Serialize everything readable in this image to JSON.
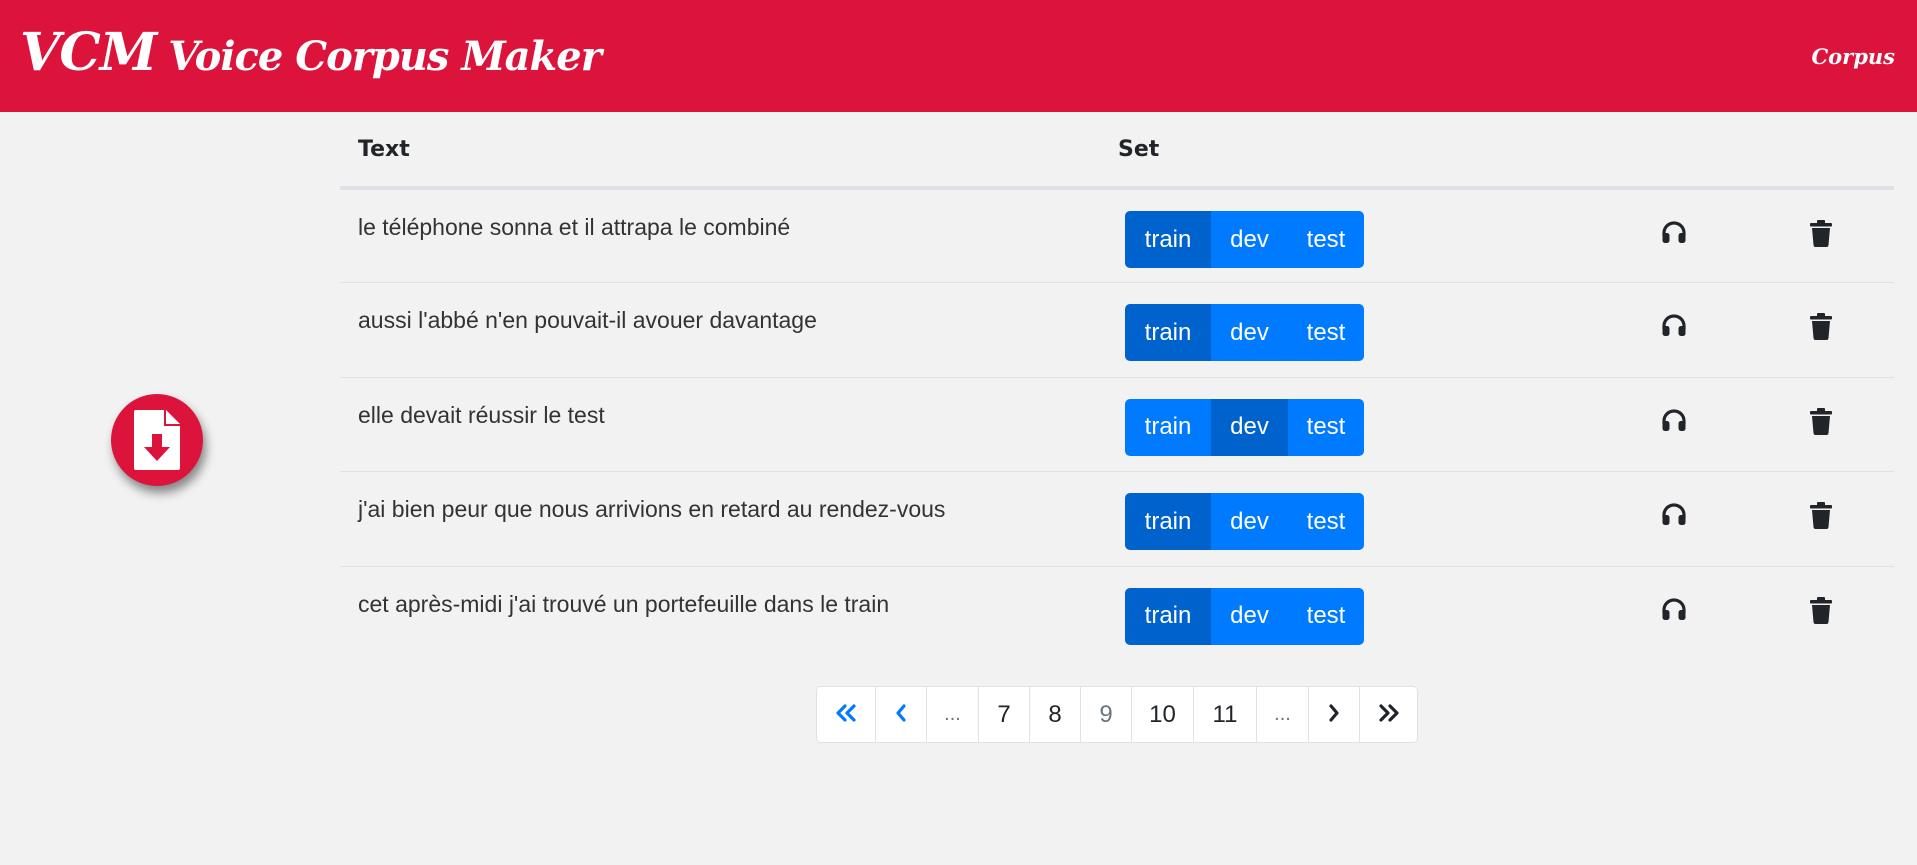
{
  "header": {
    "brand_short": "VCM",
    "brand_long": "Voice Corpus Maker",
    "nav_link": "Corpus",
    "color": "#dc143c"
  },
  "download_button": {
    "icon": "file-download-icon"
  },
  "table": {
    "headers": {
      "text": "Text",
      "set": "Set"
    },
    "rows": [
      {
        "text": "le téléphone sonna et il attrapa le combiné",
        "active_set": "train"
      },
      {
        "text": "aussi l'abbé n'en pouvait-il avouer davantage",
        "active_set": "train"
      },
      {
        "text": "elle devait réussir le test",
        "active_set": "dev"
      },
      {
        "text": "j'ai bien peur que nous arrivions en retard au rendez-vous",
        "active_set": "train"
      },
      {
        "text": "cet après-midi j'ai trouvé un portefeuille dans le train",
        "active_set": "train"
      }
    ],
    "set_options": [
      "train",
      "dev",
      "test"
    ],
    "row_icons": [
      "headphones-icon",
      "trash-icon"
    ],
    "set_button_color": "#007bff",
    "set_button_active_color": "#0062cc"
  },
  "pagination": {
    "items": [
      {
        "label": "«",
        "kind": "first",
        "icon": "double-chevron-left-icon"
      },
      {
        "label": "‹",
        "kind": "prev",
        "icon": "chevron-left-icon"
      },
      {
        "label": "...",
        "kind": "ellipsis"
      },
      {
        "label": "7",
        "kind": "page"
      },
      {
        "label": "8",
        "kind": "page"
      },
      {
        "label": "9",
        "kind": "current"
      },
      {
        "label": "10",
        "kind": "page"
      },
      {
        "label": "11",
        "kind": "page"
      },
      {
        "label": "...",
        "kind": "ellipsis"
      },
      {
        "label": "›",
        "kind": "next",
        "icon": "chevron-right-icon"
      },
      {
        "label": "»",
        "kind": "last",
        "icon": "double-chevron-right-icon"
      }
    ]
  }
}
